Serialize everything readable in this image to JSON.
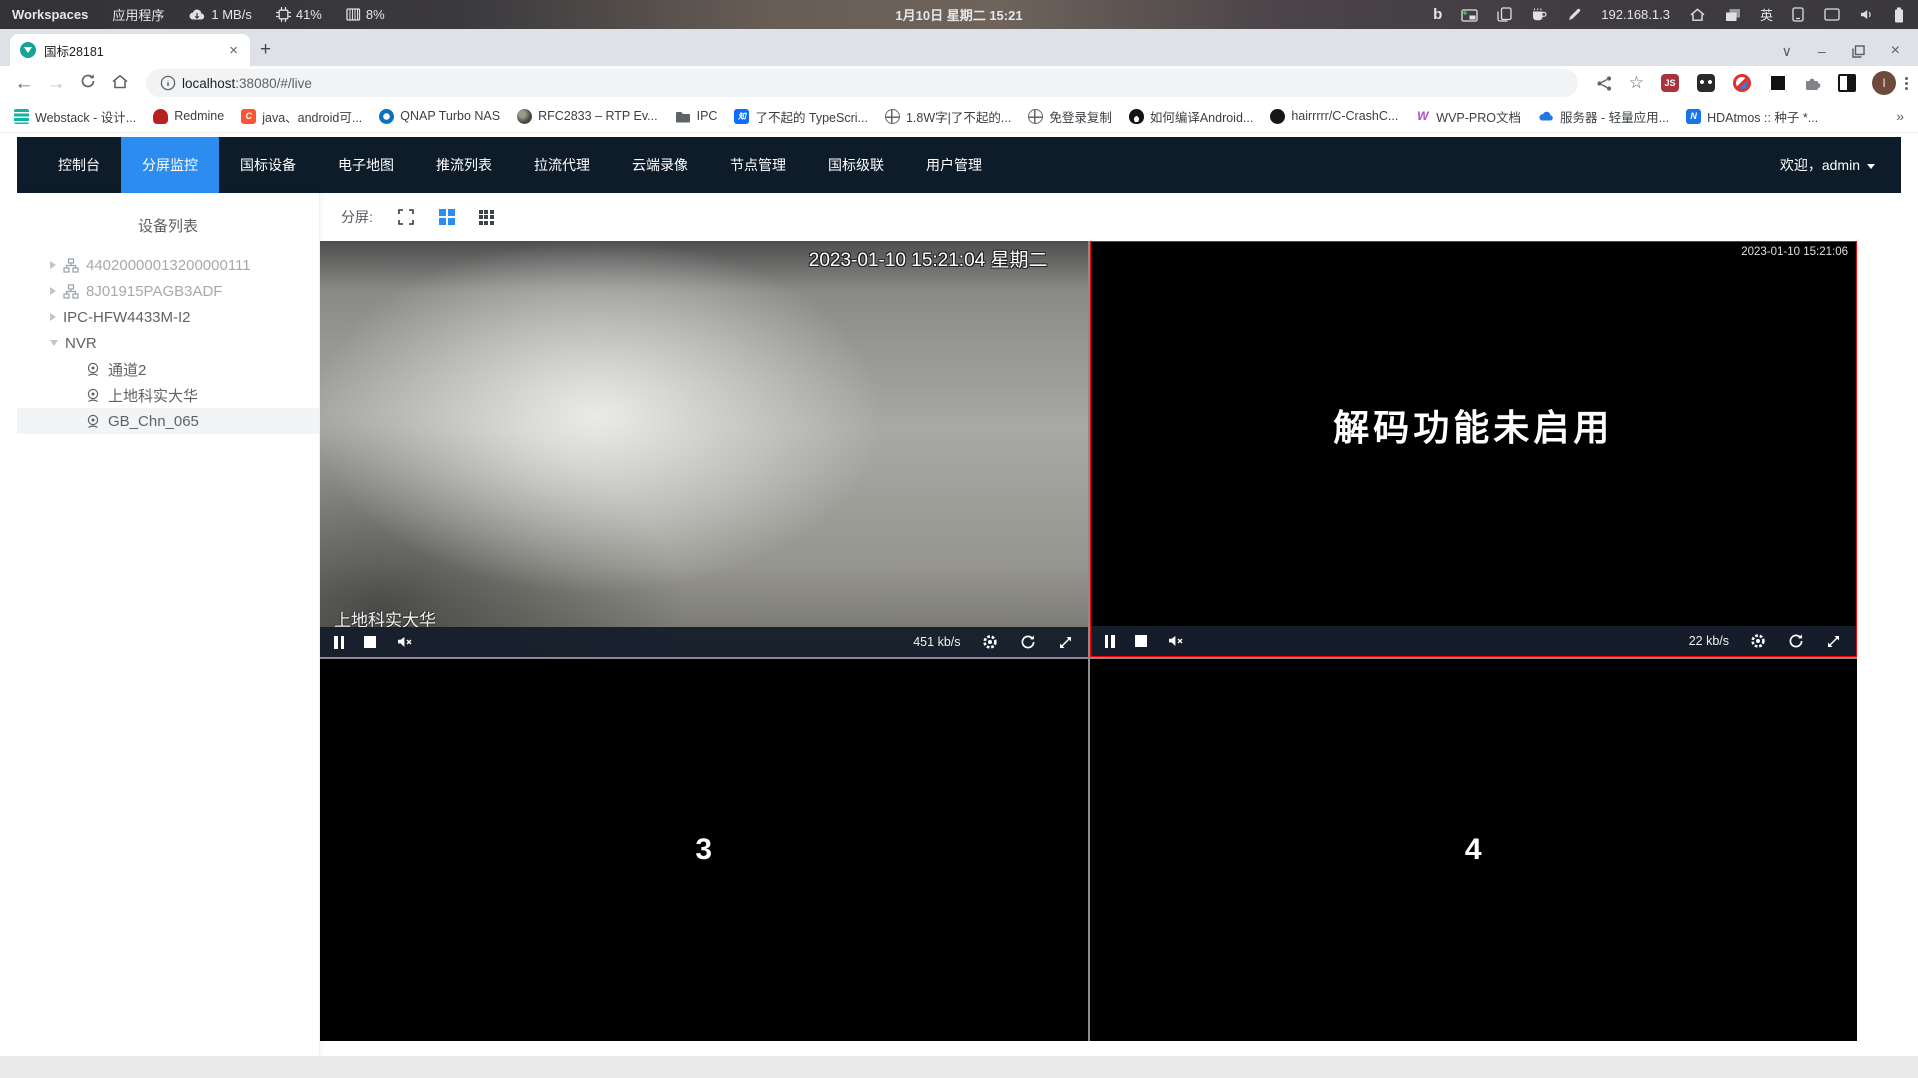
{
  "system_bar": {
    "workspaces": "Workspaces",
    "applications": "应用程序",
    "net_speed": "1 MB/s",
    "cpu_percent": "41%",
    "mem_percent": "8%",
    "clock": "1月10日 星期二 15:21",
    "ip_address": "192.168.1.3",
    "input_method": "英"
  },
  "browser": {
    "tab_title": "国标28181",
    "url_host": "localhost",
    "url_rest": ":38080/#/live",
    "ext_js_label": "JS",
    "avatar_letter": "I",
    "bookmarks": [
      {
        "label": "Webstack - 设计...",
        "icon": "webstack-layers"
      },
      {
        "label": "Redmine",
        "icon": "redmine"
      },
      {
        "label": "java、android可...",
        "icon": "csdn",
        "glyph": "C"
      },
      {
        "label": "QNAP Turbo NAS",
        "icon": "qnap"
      },
      {
        "label": "RFC2833 – RTP Ev...",
        "icon": "sphere"
      },
      {
        "label": "IPC",
        "icon": "folder"
      },
      {
        "label": "了不起的 TypeScri...",
        "icon": "zhihu",
        "glyph": "知"
      },
      {
        "label": "1.8W字|了不起的...",
        "icon": "globe"
      },
      {
        "label": "免登录复制",
        "icon": "globe"
      },
      {
        "label": "如何编译Android...",
        "icon": "penguin"
      },
      {
        "label": "hairrrrr/C-CrashC...",
        "icon": "github"
      },
      {
        "label": "WVP-PRO文档",
        "icon": "wvp",
        "glyph": "W"
      },
      {
        "label": "服务器 - 轻量应用...",
        "icon": "tencent-cloud"
      },
      {
        "label": "HDAtmos :: 种子 *...",
        "icon": "hdatmos",
        "glyph": "N"
      }
    ]
  },
  "nav": {
    "items": [
      "控制台",
      "分屏监控",
      "国标设备",
      "电子地图",
      "推流列表",
      "拉流代理",
      "云端录像",
      "节点管理",
      "国标级联",
      "用户管理"
    ],
    "welcome": "欢迎，admin"
  },
  "sidebar": {
    "title": "设备列表",
    "tree": [
      {
        "label": "44020000013200000111"
      },
      {
        "label": "8J01915PAGB3ADF"
      },
      {
        "label": "IPC-HFW4433M-I2"
      },
      {
        "label": "NVR"
      },
      {
        "label": "通道2"
      },
      {
        "label": "上地科实大华"
      },
      {
        "label": "GB_Chn_065"
      }
    ]
  },
  "toolbar": {
    "split_label": "分屏:"
  },
  "videos": [
    {
      "osd_time": "2023-01-10 15:21:04 星期二",
      "osd_label": "上地科实大华",
      "bitrate": "451 kb/s"
    },
    {
      "osd_time": "2023-01-10 15:21:06",
      "message": "解码功能未启用",
      "bitrate": "22 kb/s"
    },
    {
      "number": "3"
    },
    {
      "number": "4"
    }
  ],
  "glyphs": {
    "back": "←",
    "forward": "→",
    "star": "☆",
    "chevron_down": "∨",
    "minimize": "–",
    "close": "×",
    "tab_close": "×",
    "plus": "+",
    "overflow": "»",
    "bing": "b"
  },
  "colors": {
    "accent_blue": "#2d8cf0",
    "navbar_bg": "#0e1b29",
    "selected_border": "#ff0000",
    "teal_favicon": "#17a398"
  }
}
